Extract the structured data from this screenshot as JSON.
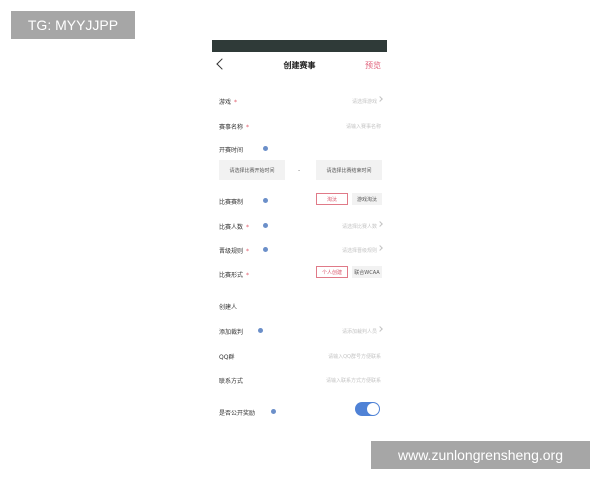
{
  "watermarks": {
    "top_left": "TG: MYYJJPP",
    "bottom_right": "www.zunlongrensheng.org"
  },
  "header": {
    "title": "创建赛事",
    "preview_label": "预览"
  },
  "form": {
    "game": {
      "label": "游戏",
      "hint": "请选择游戏"
    },
    "name": {
      "label": "赛事名称",
      "hint": "请输入赛事名称"
    },
    "start_time": {
      "label": "开赛时间",
      "start_placeholder": "请选择比赛开始时间",
      "separator": "-",
      "end_placeholder": "请选择比赛结束时间"
    },
    "format": {
      "label": "比赛赛制",
      "options": [
        "淘汰",
        "游戏淘汰"
      ],
      "selected": "淘汰"
    },
    "players": {
      "label": "比赛人数",
      "hint": "请选择比赛人数"
    },
    "promotion": {
      "label": "晋级规则",
      "hint": "请选择晋级规则"
    },
    "style": {
      "label": "比赛形式",
      "options": [
        "个人创建",
        "联合WCAA"
      ],
      "selected": "个人创建"
    },
    "creator": {
      "label": "创建人"
    },
    "referee": {
      "label": "添加裁判",
      "hint": "请添加裁判人员"
    },
    "qq_group": {
      "label": "QQ群",
      "hint": "请输入QQ群号方便联系"
    },
    "contact": {
      "label": "联系方式",
      "hint": "请输入联系方式方便联系"
    },
    "public_reward": {
      "label": "是否公开奖励",
      "enabled": true
    }
  },
  "colors": {
    "accent_pink": "#e0607a",
    "toggle_blue": "#4f82d6",
    "info_blue": "#6b8fc9",
    "status_bar": "#2f3a38"
  }
}
